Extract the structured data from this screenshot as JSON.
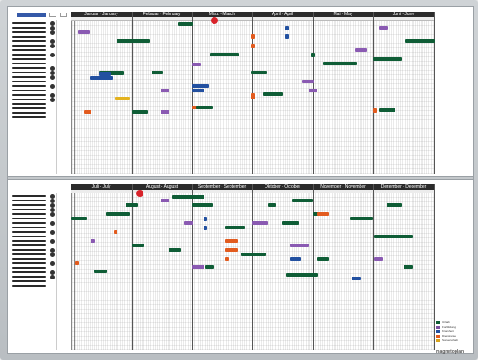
{
  "top": {
    "months": [
      "Januar - January",
      "Februar - February",
      "März - March",
      "April - April",
      "Mai - May",
      "Juni - June"
    ]
  },
  "bottom": {
    "months": [
      "Juli - July",
      "August - August",
      "September - September",
      "Oktober - October",
      "November - November",
      "Dezember - December"
    ]
  },
  "legend": {
    "items": [
      {
        "label": "Urlaub",
        "color": "#0f5d36"
      },
      {
        "label": "Fortbildung",
        "color": "#7b4fa0"
      },
      {
        "label": "Krankheit",
        "color": "#2250a0"
      },
      {
        "label": "Dienstreise",
        "color": "#e25b1e"
      },
      {
        "label": "Sonderurlaub",
        "color": "#d8a41c"
      }
    ]
  },
  "brand": "magnetoplan",
  "colors": {
    "green": "#0f5d36",
    "purple": "#8a5ab2",
    "blue": "#2250a0",
    "orange": "#e25b1e",
    "yellow": "#e3b21f",
    "red": "#d8232a"
  }
}
